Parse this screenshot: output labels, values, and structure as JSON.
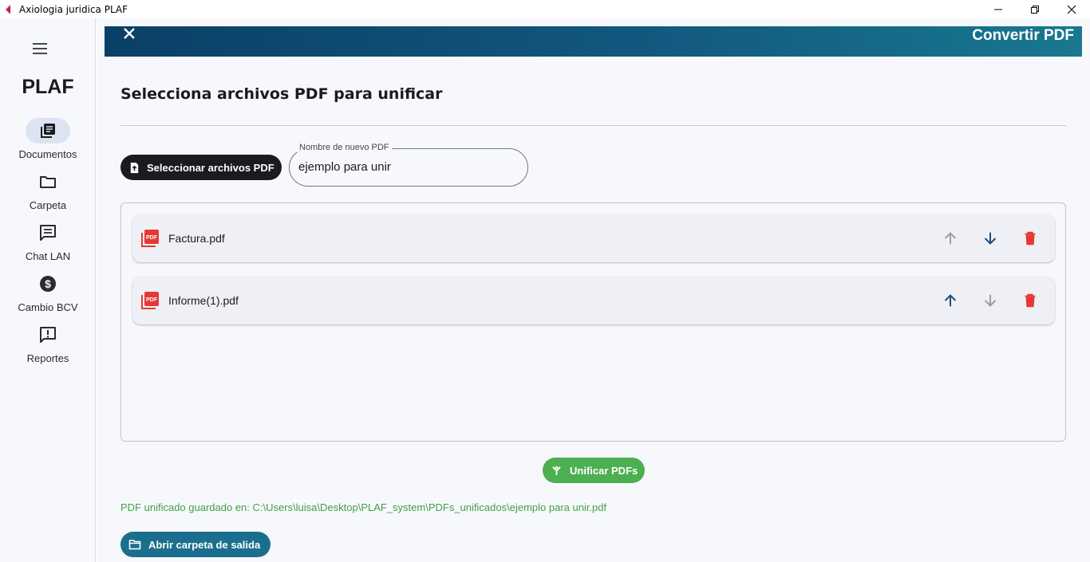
{
  "window": {
    "title": "Axiologia juridica PLAF",
    "icon": "app-logo-icon",
    "controls": [
      "minimize-icon",
      "restore-icon",
      "close-icon"
    ]
  },
  "sidebar": {
    "menu_icon": "hamburger-menu-icon",
    "brand": "PLAF",
    "items": [
      {
        "label": "Documentos",
        "icon": "documents-icon",
        "active": true
      },
      {
        "label": "Carpeta",
        "icon": "folder-icon",
        "active": false
      },
      {
        "label": "Chat LAN",
        "icon": "chat-icon",
        "active": false
      },
      {
        "label": "Cambio BCV",
        "icon": "dollar-icon",
        "active": false
      },
      {
        "label": "Reportes",
        "icon": "report-icon",
        "active": false
      }
    ]
  },
  "header": {
    "title": "Convertir PDF",
    "close_icon": "close-icon"
  },
  "main": {
    "section_title": "Selecciona archivos PDF para unificar",
    "select_button": {
      "label": "Seleccionar archivos PDF",
      "icon": "file-upload-icon"
    },
    "name_field": {
      "label": "Nombre de nuevo PDF",
      "value": "ejemplo para unir"
    },
    "files": [
      {
        "name": "Factura.pdf",
        "up_enabled": false,
        "down_enabled": true
      },
      {
        "name": "Informe(1).pdf",
        "up_enabled": true,
        "down_enabled": false
      }
    ],
    "merge_button": {
      "label": "Unificar PDFs",
      "icon": "merge-icon"
    },
    "status": "PDF unificado guardado en: C:\\Users\\luisa\\Desktop\\PLAF_system\\PDFs_unificados\\ejemplo para unir.pdf",
    "open_button": {
      "label": "Abrir carpeta de salida",
      "icon": "folder-open-icon"
    }
  },
  "colors": {
    "header_start": "#0b3f66",
    "header_end": "#19788f",
    "success": "#4caf50",
    "status_text": "#43a047",
    "delete": "#e53935",
    "arrow_active": "#1f4e79",
    "arrow_disabled": "#9e9e9e",
    "open_button": "#1b6f8e",
    "nav_active": "#dce3f3"
  }
}
